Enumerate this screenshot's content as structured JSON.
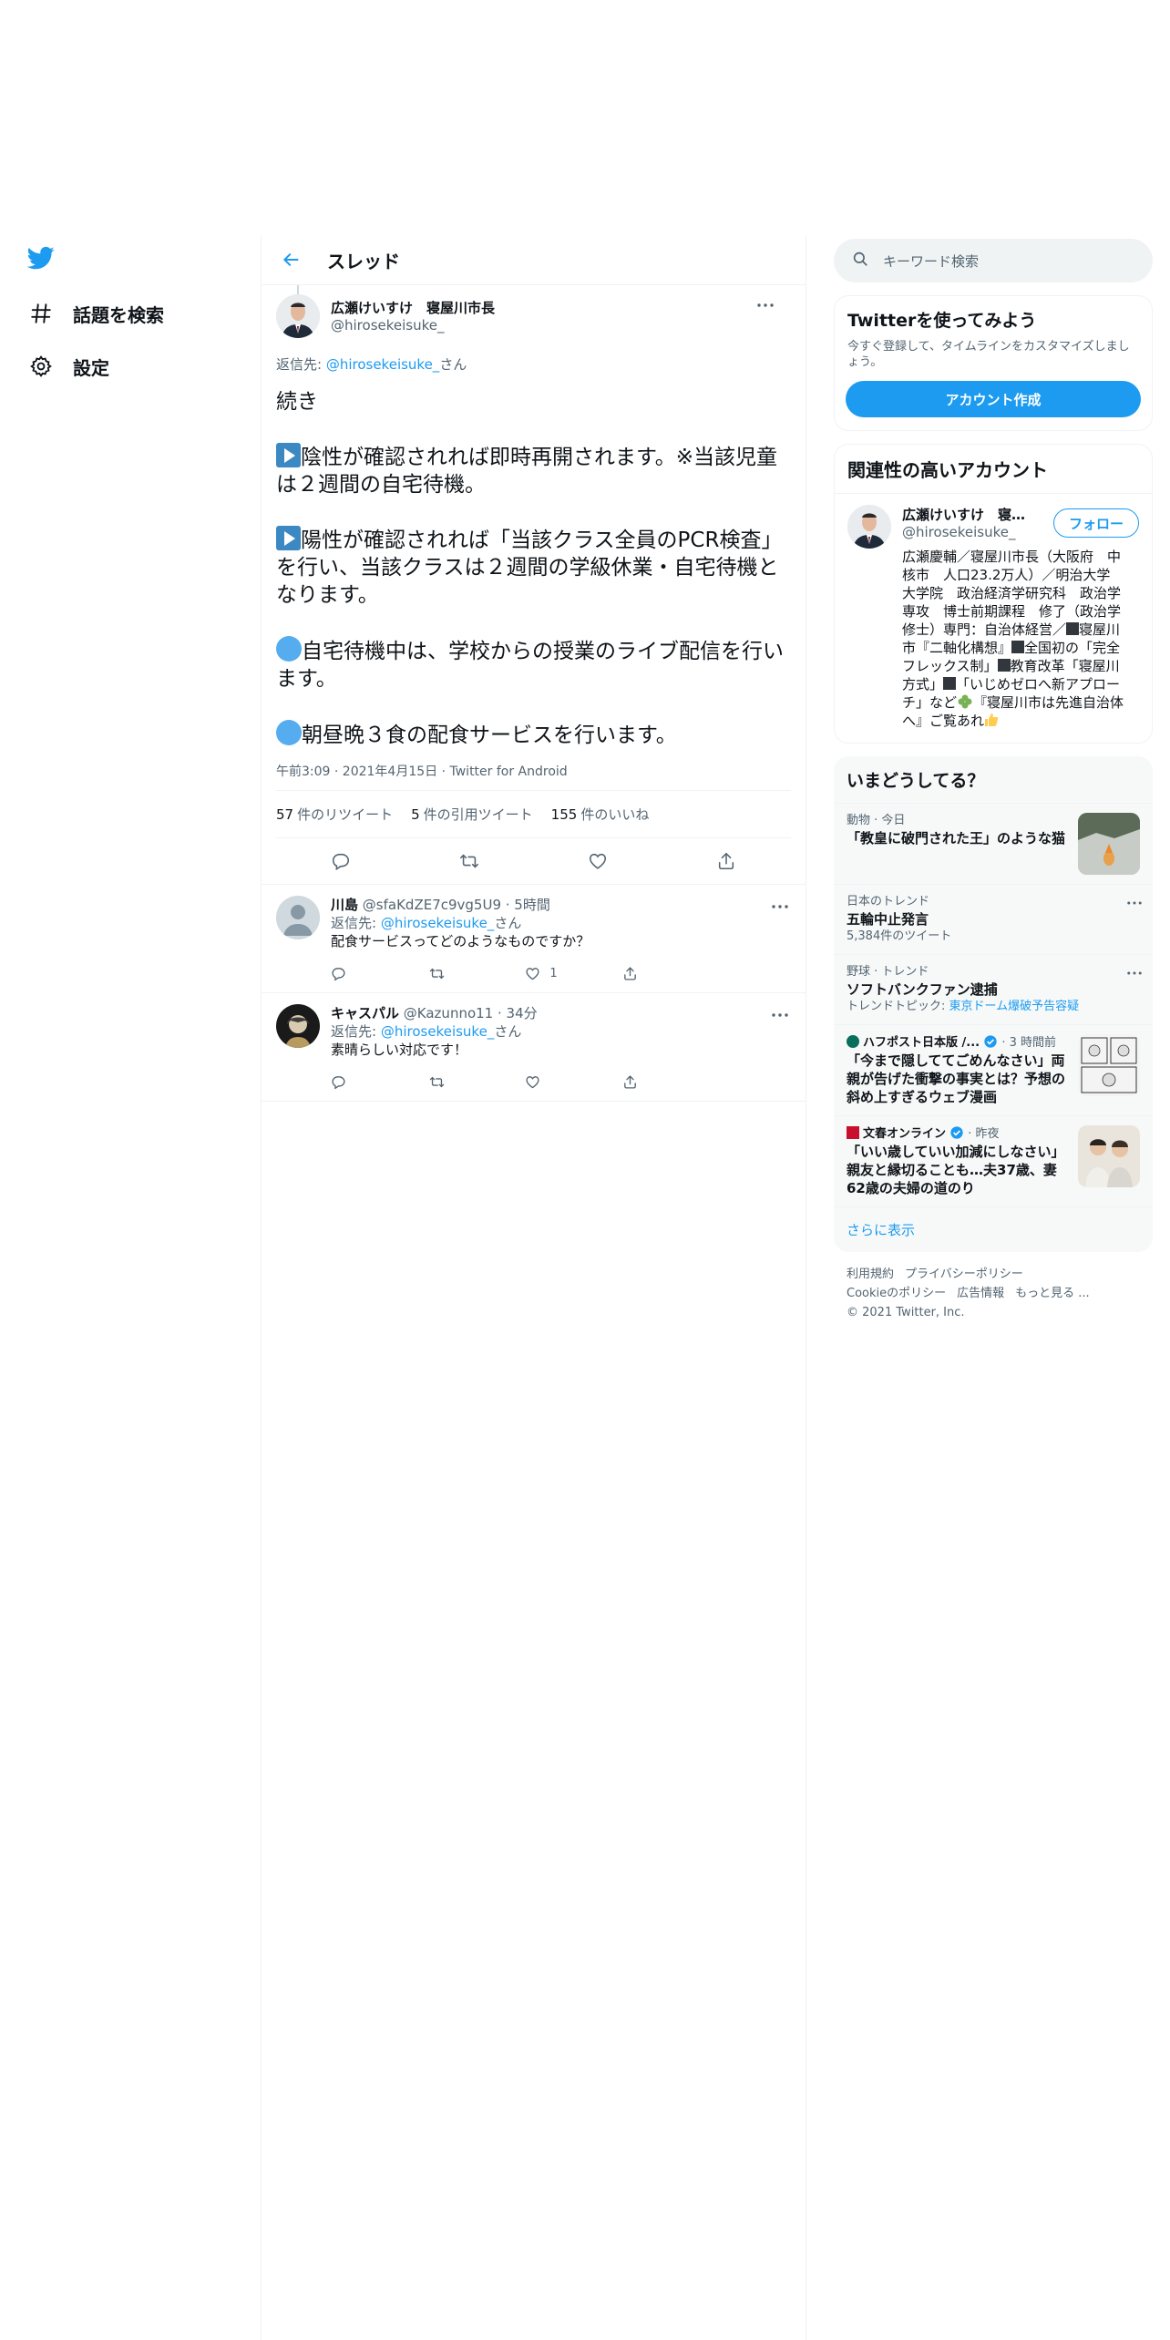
{
  "nav": {
    "explore_label": "話題を検索",
    "settings_label": "設定"
  },
  "thread": {
    "title": "スレッド"
  },
  "main_tweet": {
    "display_name": "広瀬けいすけ　寝屋川市長",
    "handle": "@hirosekeisuke_",
    "reply_prefix": "返信先: ",
    "reply_handle": "@hirosekeisuke_",
    "reply_suffix": "さん",
    "para1": "続き",
    "para2": "陰性が確認されれば即時再開されます。※当該児童は２週間の自宅待機。",
    "para3": "陽性が確認されれば「当該クラス全員のPCR検査」を行い、当該クラスは２週間の学級休業・自宅待機となります。",
    "para4": "自宅待機中は、学校からの授業のライブ配信を行います。",
    "para5": "朝昼晩３食の配食サービスを行います。",
    "meta": "午前3:09 · 2021年4月15日 · Twitter for Android",
    "retweets_count": "57",
    "retweets_label": "件のリツイート",
    "quotes_count": "5",
    "quotes_label": "件の引用ツイート",
    "likes_count": "155",
    "likes_label": "件のいいね"
  },
  "replies": [
    {
      "name": "川島",
      "handle_time": "@sfaKdZE7c9vg5U9 · 5時間",
      "reply_prefix": "返信先: ",
      "reply_handle": "@hirosekeisuke_",
      "reply_suffix": "さん",
      "text": "配食サービスってどのようなものですか？",
      "likes": "1"
    },
    {
      "name": "キャスパル",
      "handle_time": "@Kazunno11 · 34分",
      "reply_prefix": "返信先: ",
      "reply_handle": "@hirosekeisuke_",
      "reply_suffix": "さん",
      "text": "素晴らしい対応です！",
      "likes": ""
    }
  ],
  "sidebar": {
    "search_placeholder": "キーワード検索",
    "signup": {
      "title": "Twitterを使ってみよう",
      "desc": "今すぐ登録して、タイムラインをカスタマイズしましょう。",
      "button": "アカウント作成"
    },
    "related": {
      "title": "関連性の高いアカウント",
      "name": "広瀬けいすけ　寝屋川市長",
      "handle": "@hirosekeisuke_",
      "follow": "フォロー",
      "bio1": "広瀬慶輔／寝屋川市長（大阪府　中核市　人口23.2万人）／明治大学　大学院　政治経済学研究科　政治学専攻　博士前期課程　修了（政治学修士）専門：自治体経営／",
      "bio2": "寝屋川市『二軸化構想』",
      "bio3": "全国初の「完全フレックス制」",
      "bio4": "教育改革「寝屋川方式」",
      "bio5": "「いじめゼロへ新アプローチ」など",
      "bio6": "『寝屋川市は先進自治体へ』ご覧あれ"
    },
    "trends": {
      "title": "いまどうしてる？",
      "items": [
        {
          "meta": "動物 · 今日",
          "name": "「教皇に破門された王」のような猫",
          "sub": ""
        },
        {
          "meta": "日本のトレンド",
          "name": "五輪中止発言",
          "sub": "5,384件のツイート"
        },
        {
          "meta": "野球 · トレンド",
          "name": "ソフトバンクファン逮捕",
          "sub_prefix": "トレンドトピック: ",
          "sub_link": "東京ドーム爆破予告容疑"
        },
        {
          "source": "ハフポスト日本版 /...",
          "time": " · 3 時間前",
          "name": "「今まで隠しててごめんなさい」両親が告げた衝撃の事実とは？予想の斜め上すぎるウェブ漫画"
        },
        {
          "source": "文春オンライン",
          "time": " · 昨夜",
          "name": "「いい歳していい加減にしなさい」親友と縁切ることも…夫37歳、妻62歳の夫婦の道のり"
        }
      ],
      "show_more": "さらに表示"
    },
    "footer": {
      "terms": "利用規約",
      "privacy": "プライバシーポリシー",
      "cookie": "Cookieのポリシー",
      "ads": "広告情報",
      "more": "もっと見る ...",
      "copyright": "© 2021 Twitter, Inc."
    }
  },
  "colors": {
    "accent": "#1d9bf0",
    "text": "#0f1419",
    "secondary": "#536471",
    "border": "#eff3f4"
  }
}
